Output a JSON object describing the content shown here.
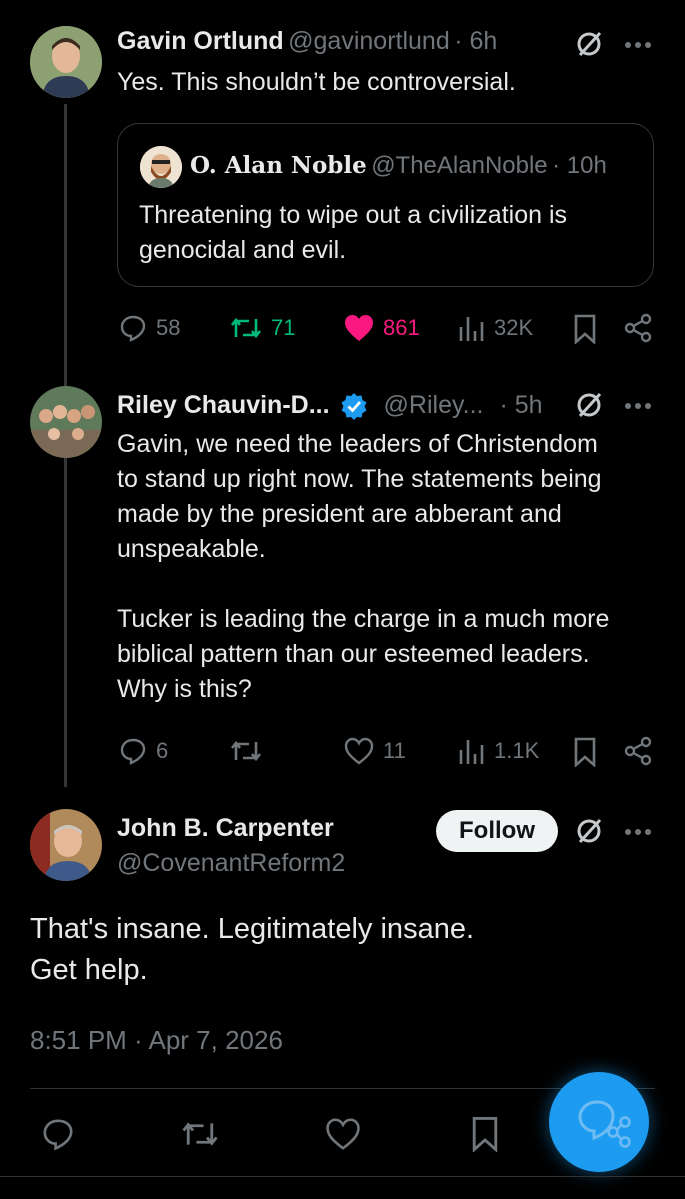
{
  "tweet1": {
    "name": "Gavin Ortlund",
    "handle": "@gavinortlund",
    "time": "· 6h",
    "text": "Yes. This shouldn’t be controversial.",
    "quote": {
      "name": "O. Alan Noble",
      "handle": "@TheAlanNoble",
      "time": "· 10h",
      "text_line1": "Threatening to wipe out a civilization is",
      "text_line2": "genocidal and evil."
    },
    "replies": "58",
    "reposts": "71",
    "likes": "861",
    "views": "32K"
  },
  "tweet2": {
    "name": "Riley Chauvin-D...",
    "handle": "@Riley...",
    "time": "· 5h",
    "lines": [
      "Gavin, we need the leaders of Christendom",
      "to stand up right now. The statements being",
      "made by the president are abberant and",
      "unspeakable.",
      "",
      "Tucker is leading the charge in a much more",
      "biblical pattern than our esteemed leaders.",
      "Why is this?"
    ],
    "replies": "6",
    "likes": "11",
    "views": "1.1K"
  },
  "tweet3": {
    "name": "John B. Carpenter",
    "handle": "@CovenantReform2",
    "follow_label": "Follow",
    "text_line1": "That's insane. Legitimately insane.",
    "text_line2": "Get help.",
    "timestamp": "8:51 PM · Apr 7, 2026"
  },
  "colors": {
    "background": "#000000",
    "text": "#e7e9ea",
    "muted": "#71767b",
    "repost_green": "#00ba7c",
    "like_pink": "#f91880",
    "verified_blue": "#1d9bf0"
  }
}
